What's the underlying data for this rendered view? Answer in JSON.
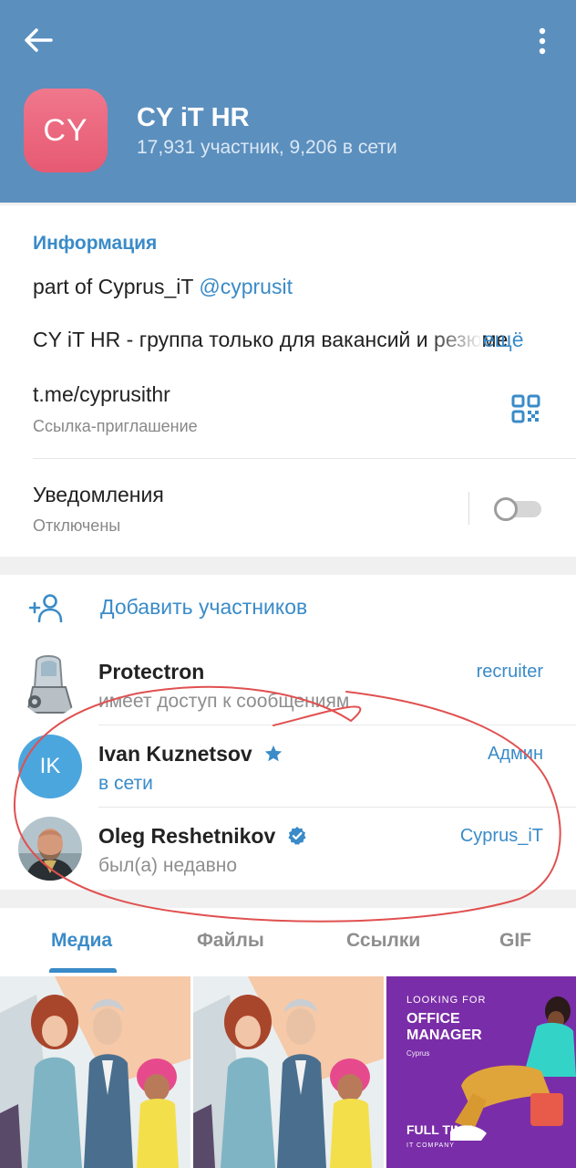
{
  "header": {
    "avatar_initials": "CY",
    "title": "CY iT HR",
    "subtitle": "17,931 участник, 9,206 в сети",
    "back_icon": "arrow-left-icon",
    "menu_icon": "more-vertical-icon"
  },
  "info": {
    "section_title": "Информация",
    "about_prefix": "part of Cyprus_iT ",
    "about_mention": "@cyprusit",
    "description": "CY iT HR - группа только для вакансий и резюме",
    "more_label": "ещё",
    "link": "t.me/cyprusithr",
    "link_caption": "Ссылка-приглашение",
    "notifications_label": "Уведомления",
    "notifications_status": "Отключены",
    "notifications_enabled": false
  },
  "members": {
    "add_label": "Добавить участников",
    "items": [
      {
        "name": "Protectron",
        "status": "имеет доступ к сообщениям",
        "role": "recruiter"
      },
      {
        "initials": "IK",
        "name": "Ivan Kuznetsov",
        "status": "в сети",
        "role": "Админ",
        "badge": "star-icon"
      },
      {
        "name": "Oleg Reshetnikov",
        "status": "был(а) недавно",
        "role": "Cyprus_iT",
        "badge": "verified-icon"
      }
    ]
  },
  "media": {
    "tabs": [
      "Медиа",
      "Файлы",
      "Ссылки",
      "GIF"
    ],
    "active_tab": "Медиа",
    "ad": {
      "line1": "LOOKING FOR",
      "line2": "OFFICE MANAGER",
      "line3": "Cyprus",
      "line4": "FULL TIME",
      "line5": "IT COMPANY"
    }
  },
  "colors": {
    "header": "#5b8fbe",
    "accent": "#3a8bc8",
    "avatar_cy": "#ea6a80",
    "avatar_ik": "#4ba6dd",
    "annotation": "#e05050"
  }
}
